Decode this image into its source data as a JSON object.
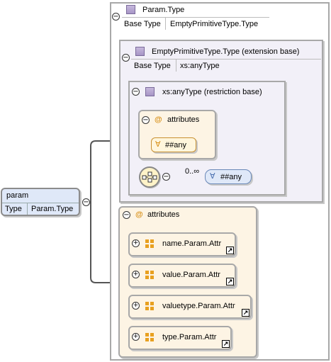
{
  "param": {
    "name": "param",
    "type_label": "Type",
    "type_value": "Param.Type"
  },
  "param_type": {
    "name": "Param.Type",
    "base_label": "Base Type",
    "base_value": "EmptyPrimitiveType.Type"
  },
  "empty_primitive": {
    "name": "EmptyPrimitiveType.Type (extension base)",
    "base_label": "Base Type",
    "base_value": "xs:anyType"
  },
  "any_type": {
    "name": "xs:anyType (restriction base)"
  },
  "inner_attributes": {
    "label": "attributes",
    "any_attr": "##any"
  },
  "sequence": {
    "occurrence": "0..∞",
    "any_element": "##any"
  },
  "outer_attributes": {
    "label": "attributes",
    "items": [
      "name.Param.Attr",
      "value.Param.Attr",
      "valuetype.Param.Attr",
      "type.Param.Attr"
    ]
  },
  "colors": {
    "border": "#a8a8a8",
    "lavender": "#f2f0f8",
    "cream": "#fdf4e4",
    "blue": "#dfe8f8"
  }
}
